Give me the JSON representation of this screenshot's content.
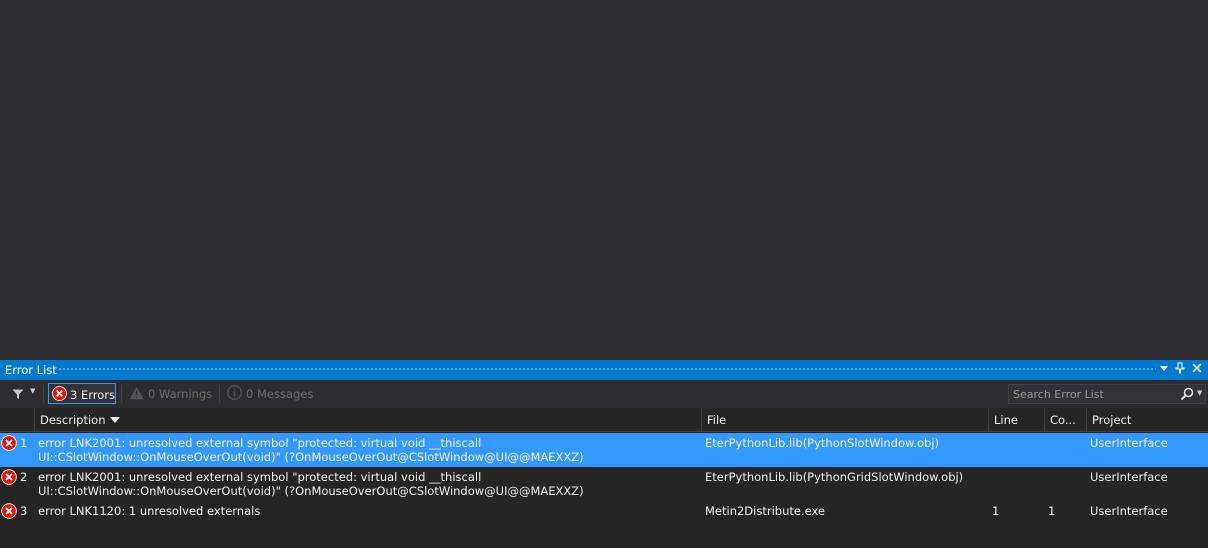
{
  "panel": {
    "title": "Error List"
  },
  "toolbar": {
    "errors_label": "3 Errors",
    "warnings_label": "0 Warnings",
    "messages_label": "0 Messages",
    "search_placeholder": "Search Error List"
  },
  "columns": {
    "description": "Description",
    "file": "File",
    "line": "Line",
    "column": "Co...",
    "project": "Project"
  },
  "rows": [
    {
      "index": "1",
      "description": "error LNK2001: unresolved external symbol \"protected: virtual void __thiscall UI::CSlotWindow::OnMouseOverOut(void)\" (?OnMouseOverOut@CSlotWindow@UI@@MAEXXZ)",
      "file": "EterPythonLib.lib(PythonSlotWindow.obj)",
      "line": "",
      "column": "",
      "project": "UserInterface",
      "selected": true
    },
    {
      "index": "2",
      "description": "error LNK2001: unresolved external symbol \"protected: virtual void __thiscall UI::CSlotWindow::OnMouseOverOut(void)\" (?OnMouseOverOut@CSlotWindow@UI@@MAEXXZ)",
      "file": "EterPythonLib.lib(PythonGridSlotWindow.obj)",
      "line": "",
      "column": "",
      "project": "UserInterface",
      "selected": false
    },
    {
      "index": "3",
      "description": "error LNK1120: 1 unresolved externals",
      "file": "Metin2Distribute.exe",
      "line": "1",
      "column": "1",
      "project": "UserInterface",
      "selected": false
    }
  ],
  "colors": {
    "accent": "#007acc",
    "selection": "#3399ff",
    "error_icon": "#e51400",
    "background": "#2d2d30"
  },
  "icons": [
    "filter-icon",
    "error-icon",
    "warning-icon",
    "info-icon",
    "search-icon",
    "pin-icon",
    "close-icon",
    "dropdown-icon"
  ]
}
